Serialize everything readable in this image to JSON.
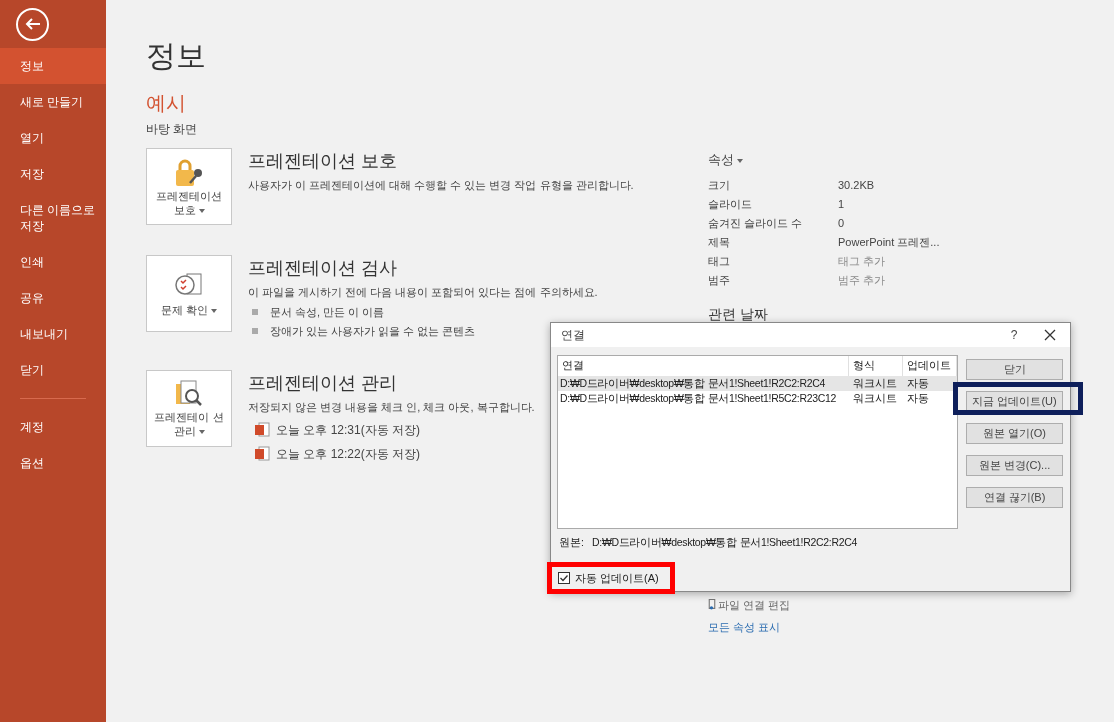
{
  "sidebar": {
    "items": [
      {
        "label": "정보",
        "selected": true
      },
      {
        "label": "새로 만들기",
        "selected": false
      },
      {
        "label": "열기",
        "selected": false
      },
      {
        "label": "저장",
        "selected": false
      },
      {
        "label": "다른 이름으로 저장",
        "selected": false
      },
      {
        "label": "인쇄",
        "selected": false
      },
      {
        "label": "공유",
        "selected": false
      },
      {
        "label": "내보내기",
        "selected": false
      },
      {
        "label": "닫기",
        "selected": false
      }
    ],
    "bottom_items": [
      {
        "label": "계정",
        "selected": false
      },
      {
        "label": "옵션",
        "selected": false
      }
    ]
  },
  "page_title": "정보",
  "file_name": "예시",
  "file_location": "바탕 화면",
  "sections": [
    {
      "kind": "lock",
      "button": "프레젠테이션 보호",
      "title": "프레젠테이션 보호",
      "description": "사용자가 이 프레젠테이션에 대해 수행할 수 있는 변경 작업 유형을 관리합니다."
    },
    {
      "kind": "check",
      "button": "문제 확인",
      "title": "프레젠테이션 검사",
      "description": "이 파일을 게시하기 전에 다음 내용이 포함되어 있다는 점에 주의하세요.",
      "bullets": [
        "문서 속성, 만든 이 이름",
        "장애가 있는 사용자가 읽을 수 없는 콘텐츠"
      ]
    },
    {
      "kind": "manage",
      "button": "프레젠테이 션 관리",
      "title": "프레젠테이션 관리",
      "description": "저장되지 않은 변경 내용을 체크 인, 체크 아웃, 복구합니다.",
      "versions": [
        "오늘 오후 12:31(자동 저장)",
        "오늘 오후 12:22(자동 저장)"
      ]
    }
  ],
  "properties": {
    "title": "속성",
    "rows": [
      {
        "label": "크기",
        "value": "30.2KB",
        "kind": "text"
      },
      {
        "label": "슬라이드",
        "value": "1",
        "kind": "text"
      },
      {
        "label": "숨겨진 슬라이드 수",
        "value": "0",
        "kind": "text"
      },
      {
        "label": "제목",
        "value": "PowerPoint 프레젠...",
        "kind": "text"
      },
      {
        "label": "태그",
        "value": "태그 추가",
        "kind": "hint"
      },
      {
        "label": "범주",
        "value": "범주 추가",
        "kind": "hint"
      }
    ]
  },
  "related_dates": {
    "title": "관련 날짜"
  },
  "links": [
    {
      "label": "파일 연결 편집",
      "kind": "icon"
    },
    {
      "label": "모든 속성 표시",
      "kind": "link"
    }
  ],
  "dialog": {
    "title": "연결",
    "help": "?",
    "columns": [
      "연결",
      "형식",
      "업데이트"
    ],
    "rows": [
      {
        "source": "D:₩D드라이버₩desktop₩통합 문서1!Sheet1!R2C2:R2C4",
        "type": "워크시트",
        "update": "자동",
        "selected": true
      },
      {
        "source": "D:₩D드라이버₩desktop₩통합 문서1!Sheet1!R5C2:R23C12",
        "type": "워크시트",
        "update": "자동",
        "selected": false
      }
    ],
    "buttons": [
      {
        "label": "닫기",
        "highlighted": false
      },
      {
        "label": "지금 업데이트(U)",
        "highlighted": true
      },
      {
        "label": "원본 열기(O)",
        "highlighted": false
      },
      {
        "label": "원본 변경(C)...",
        "highlighted": false
      },
      {
        "label": "연결 끊기(B)",
        "highlighted": false
      }
    ],
    "source_label": "원본:",
    "source_value": "D:₩D드라이버₩desktop₩통합 문서1!Sheet1!R2C2:R2C4",
    "auto_update": {
      "label": "자동 업데이트(A)",
      "checked": true,
      "highlighted": true
    }
  }
}
